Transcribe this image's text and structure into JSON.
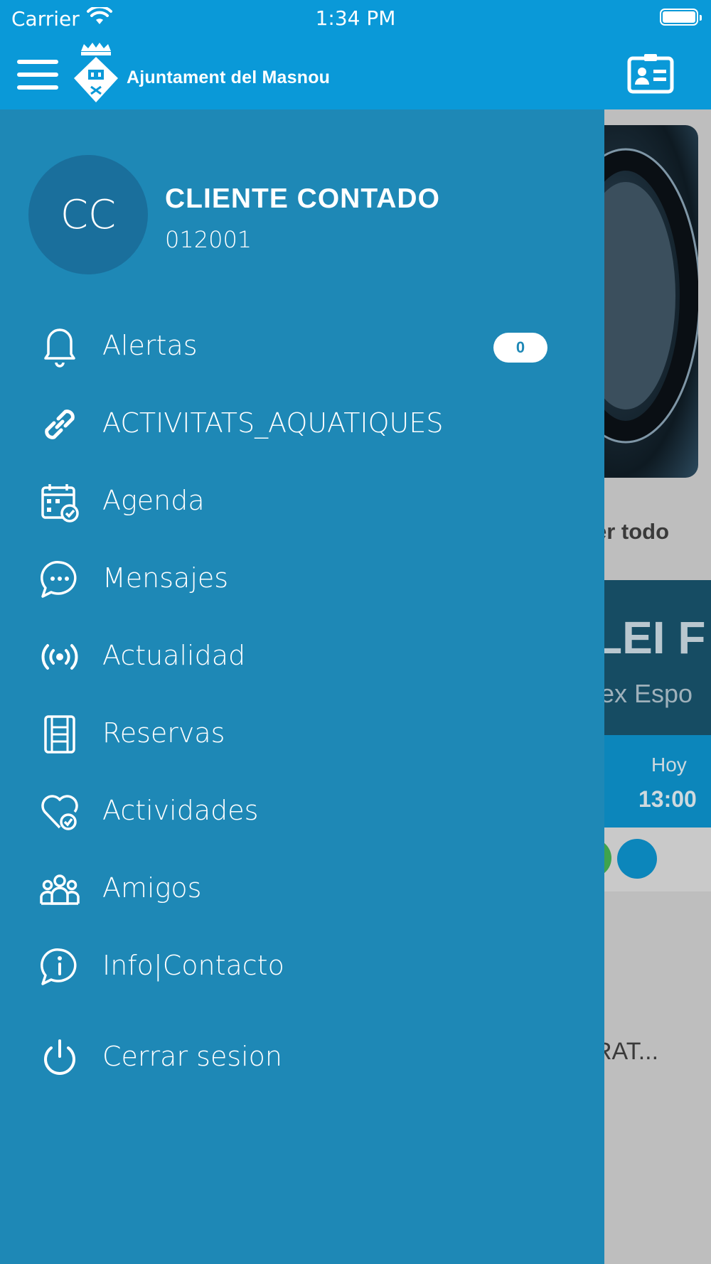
{
  "status_bar": {
    "carrier": "Carrier",
    "time": "1:34 PM"
  },
  "header": {
    "logo_text": "Ajuntament del Masnou"
  },
  "profile": {
    "initials": "CC",
    "name": "CLIENTE CONTADO",
    "code": "012001"
  },
  "menu": {
    "items": [
      {
        "label": "Alertas",
        "icon": "bell-icon",
        "badge": "0"
      },
      {
        "label": "ACTIVITATS_AQUATIQUES",
        "icon": "link-icon"
      },
      {
        "label": "Agenda",
        "icon": "calendar-check-icon"
      },
      {
        "label": "Mensajes",
        "icon": "chat-bubble-icon"
      },
      {
        "label": "Actualidad",
        "icon": "broadcast-icon"
      },
      {
        "label": "Reservas",
        "icon": "film-strip-icon"
      },
      {
        "label": "Actividades",
        "icon": "heart-check-icon"
      },
      {
        "label": "Amigos",
        "icon": "group-icon"
      },
      {
        "label": "Info|Contacto",
        "icon": "info-bubble-icon"
      }
    ],
    "logout": {
      "label": "Cerrar sesion",
      "icon": "power-icon"
    }
  },
  "background": {
    "see_all": "er todo",
    "event_title": "LEI F",
    "event_subtitle": "lex Espo",
    "event_day": "Hoy",
    "event_time": "13:00",
    "item_title": "RAT..."
  },
  "colors": {
    "header": "#0a99d8",
    "drawer": "#1e88b6",
    "avatar": "#1a6f9c"
  }
}
